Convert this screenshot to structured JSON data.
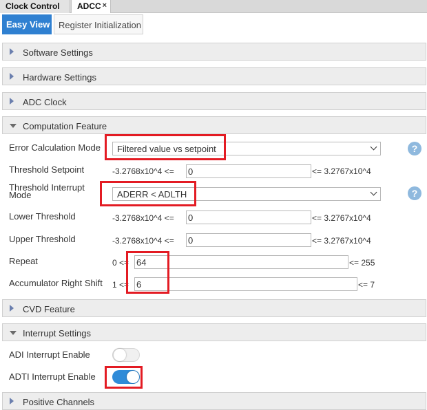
{
  "editor_tabs": [
    {
      "label": "Clock Control"
    },
    {
      "label": "ADCC",
      "close": "×"
    }
  ],
  "view_tabs": [
    {
      "label": "Easy View",
      "active": true
    },
    {
      "label": "Register Initialization",
      "active": false
    }
  ],
  "sections": {
    "software": "Software Settings",
    "hardware": "Hardware Settings",
    "adc_clock": "ADC Clock",
    "computation": "Computation Feature",
    "cvd": "CVD Feature",
    "interrupt": "Interrupt Settings",
    "positive": "Positive Channels"
  },
  "computation": {
    "error_calc_label": "Error Calculation Mode",
    "error_calc_value": "Filtered value vs setpoint",
    "threshold_setpoint_label": "Threshold Setpoint",
    "threshold_setpoint_min": "-3.2768x10^4  <=",
    "threshold_setpoint_value": "0",
    "threshold_setpoint_max": "<= 3.2767x10^4",
    "threshold_interrupt_label_1": "Threshold Interrupt",
    "threshold_interrupt_label_2": "Mode",
    "threshold_interrupt_value": "ADERR < ADLTH",
    "lower_threshold_label": "Lower Threshold",
    "lower_threshold_min": "-3.2768x10^4  <=",
    "lower_threshold_value": "0",
    "lower_threshold_max": "<= 3.2767x10^4",
    "upper_threshold_label": "Upper Threshold",
    "upper_threshold_min": "-3.2768x10^4  <=",
    "upper_threshold_value": "0",
    "upper_threshold_max": "<= 3.2767x10^4",
    "repeat_label": "Repeat",
    "repeat_min": "0  <=",
    "repeat_value": "64",
    "repeat_max": "<= 255",
    "accum_label": "Accumulator Right Shift",
    "accum_min": "1  <=",
    "accum_value": "6",
    "accum_max": "<= 7",
    "help_glyph": "?"
  },
  "interrupts": {
    "adi_label": "ADI Interrupt Enable",
    "adi_enabled": false,
    "adti_label": "ADTI Interrupt Enable",
    "adti_enabled": true
  },
  "colors": {
    "accent": "#2f80d1",
    "highlight": "#e31b23",
    "toggle_on": "#2f8bd8"
  },
  "icons": {
    "collapsed": "chevron-right-icon",
    "expanded": "chevron-down-icon",
    "help": "help-icon",
    "close": "close-icon"
  }
}
